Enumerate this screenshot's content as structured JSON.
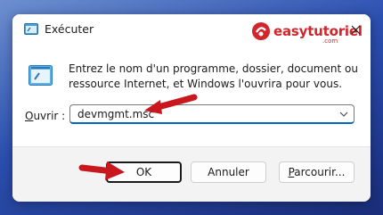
{
  "window": {
    "title": "Exécuter",
    "close_label": "✕"
  },
  "watermark": {
    "text": "easytutoriel",
    "suffix": ".com"
  },
  "content": {
    "description": "Entrez le nom d'un programme, dossier, document ou ressource Internet, et Windows l'ouvrira pour vous.",
    "open_label_accel": "O",
    "open_label_rest": "uvrir :",
    "open_value": "devmgmt.msc"
  },
  "buttons": {
    "ok": "OK",
    "cancel": "Annuler",
    "browse_accel": "P",
    "browse_rest": "arcourir..."
  },
  "colors": {
    "accent": "#0067c0",
    "annotation_arrow": "#c8171d"
  }
}
